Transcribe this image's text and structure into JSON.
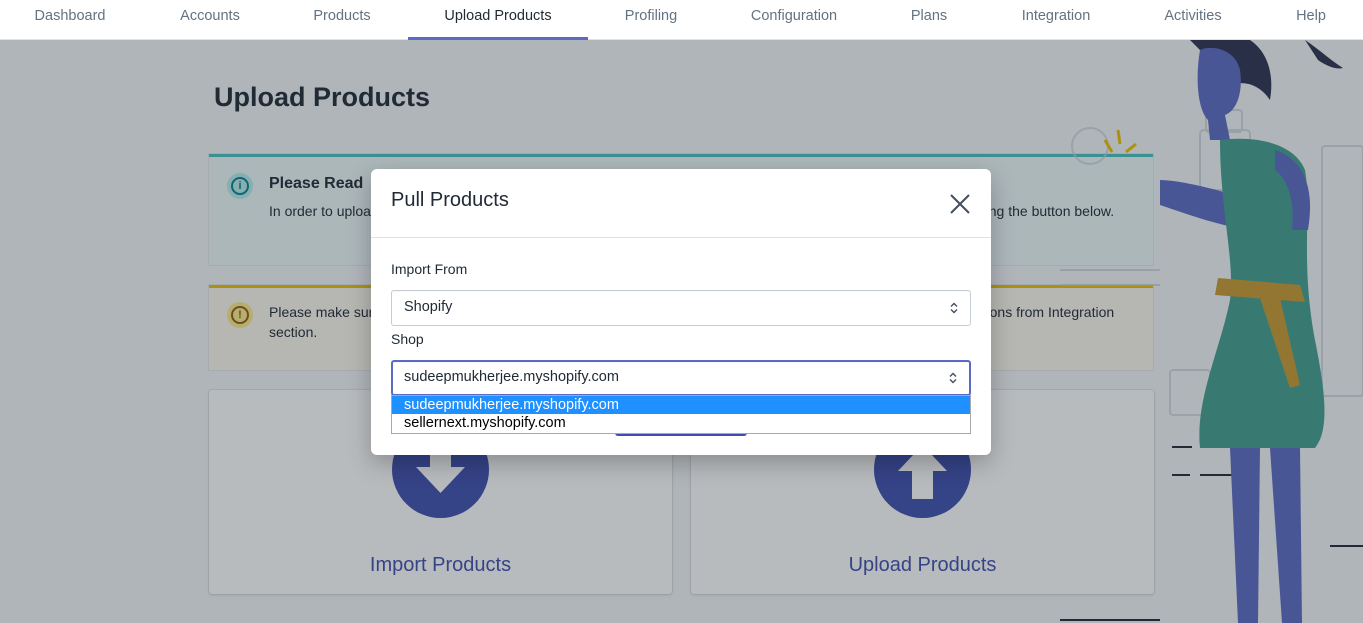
{
  "nav": {
    "items": [
      {
        "label": "Dashboard"
      },
      {
        "label": "Accounts"
      },
      {
        "label": "Products"
      },
      {
        "label": "Upload Products"
      },
      {
        "label": "Profiling"
      },
      {
        "label": "Configuration"
      },
      {
        "label": "Plans"
      },
      {
        "label": "Integration"
      },
      {
        "label": "Activities"
      },
      {
        "label": "Help"
      }
    ],
    "active": "Upload Products"
  },
  "page": {
    "title": "Upload Products",
    "info_banner": {
      "title": "Please Read",
      "text": "In order to upload products, first import them from the source. You can import your products from the source by clicking the button below."
    },
    "warning_banner": {
      "text": "Please make sure the required integration is active before you proceed to import. You can check your active integrations from Integration section."
    },
    "cards": {
      "import_label": "Import Products",
      "upload_label": "Upload Products"
    }
  },
  "modal": {
    "title": "Pull Products",
    "import_from_label": "Import From",
    "import_from_value": "Shopify",
    "shop_label": "Shop",
    "shop_value": "sudeepmukherjee.myshopify.com",
    "shop_options": [
      {
        "label": "sudeepmukherjee.myshopify.com",
        "selected": true
      },
      {
        "label": "sellernext.myshopify.com",
        "selected": false
      }
    ]
  },
  "colors": {
    "accent": "#5c6ac4",
    "brand_indigo": "#3f4eae",
    "info_border": "#47c1bf",
    "warning_border": "#eec200",
    "dropdown_highlight": "#1e90ff"
  }
}
